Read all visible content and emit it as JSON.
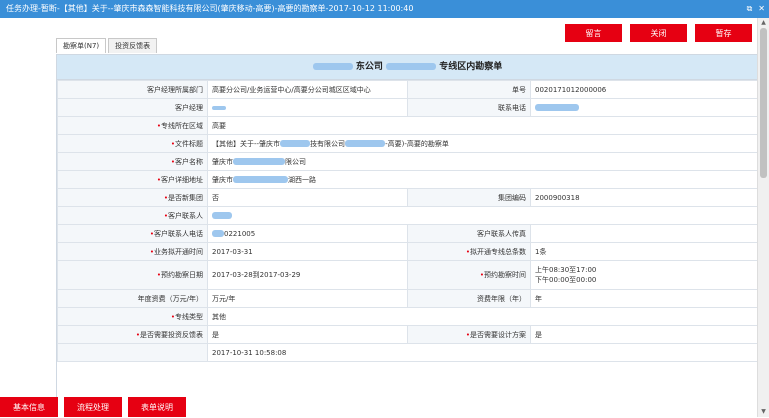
{
  "window": {
    "title": "任务办理-暂断-【其他】关于--肇庆市森森智能科技有限公司(肇庆移动-高要)-高要的勘察单-2017-10-12 11:00:40",
    "restore_glyph": "⧉",
    "close_glyph": "✕"
  },
  "actions": {
    "leave_message": "留言",
    "close": "关闭",
    "save": "暂存"
  },
  "tabs": [
    {
      "label": "勘察单(N7)"
    },
    {
      "label": "投资反馈表"
    }
  ],
  "form": {
    "title_left": "东公司",
    "title_right": "专线区内勘察单",
    "rows": {
      "dept_label": "客户经理所属部门",
      "dept_value": "高要分公司/业务运营中心/高要分公司城区区域中心",
      "order_no_label": "单号",
      "order_no_value": "0020171012000006",
      "manager_label": "客户经理",
      "manager_value": "",
      "phone_label": "联系电话",
      "phone_value": "",
      "area_label": "专线所在区域",
      "area_value": "高要",
      "file_title_label": "文件标题",
      "file_title_value_a": "【其他】关于--肇庆市",
      "file_title_value_b": "技有限公司",
      "file_title_value_c": "-高要)-高要的勘察单",
      "customer_name_label": "客户名称",
      "customer_name_value_a": "肇庆市",
      "customer_name_value_b": "限公司",
      "customer_addr_label": "客户详细地址",
      "customer_addr_value_a": "肇庆市",
      "customer_addr_value_b": "湖西一路",
      "new_group_label": "是否新集团",
      "new_group_value": "否",
      "group_code_label": "集团编码",
      "group_code_value": "2000900318",
      "contact_label": "客户联系人",
      "contact_value": "",
      "contact_phone_label": "客户联系人电话",
      "contact_phone_value": "0221005",
      "contact_fax_label": "客户联系人传真",
      "contact_fax_value": "",
      "open_time_label": "业务拟开通时间",
      "open_time_value": "2017-03-31",
      "line_count_label": "拟开通专线总条数",
      "line_count_value": "1条",
      "survey_date_label": "预约勘察日期",
      "survey_date_value": "2017-03-28到2017-03-29",
      "survey_time_label": "预约勘察时间",
      "survey_time_am": "上午08:30至17:00",
      "survey_time_pm": "下午00:00至00:00",
      "annual_fee_label": "年度资费（万元/年）",
      "annual_fee_value": "万元/年",
      "fee_years_label": "资费年限（年）",
      "fee_years_value": "年",
      "line_type_label": "专线类型",
      "line_type_value": "其他",
      "need_invest_label": "是否需要投资反馈表",
      "need_invest_value": "是",
      "need_design_label": "是否需要设计方案",
      "need_design_value": "是",
      "time_value": "2017-10-31 10:58:08"
    }
  },
  "bottom": {
    "basic_info": "基本信息",
    "process": "流程处理",
    "form_help": "表单说明"
  },
  "colors": {
    "titlebar": "#3a8fd8",
    "action_red": "#e60012",
    "header_blue": "#d5e8f6"
  }
}
